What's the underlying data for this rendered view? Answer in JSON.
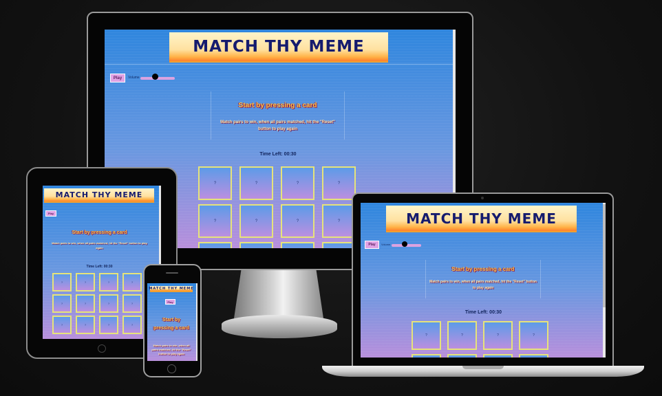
{
  "game": {
    "title": "MATCH THY MEME",
    "play_label": "Play",
    "volume_label": "Volume",
    "volume_level": 0.3,
    "headline": "Start by pressing a card",
    "instructions": "Match pairs to win, when all pairs matched, hit the \"Reset\" button to play again",
    "timer": "Time Left: 00:30",
    "card_face": "?"
  },
  "colors": {
    "background": "#141414",
    "screen_top": "#2f86de",
    "screen_bottom": "#b88fdc",
    "title_text": "#151b6e",
    "card_border": "#e6e37a",
    "play_button": "#e0a2e4"
  }
}
